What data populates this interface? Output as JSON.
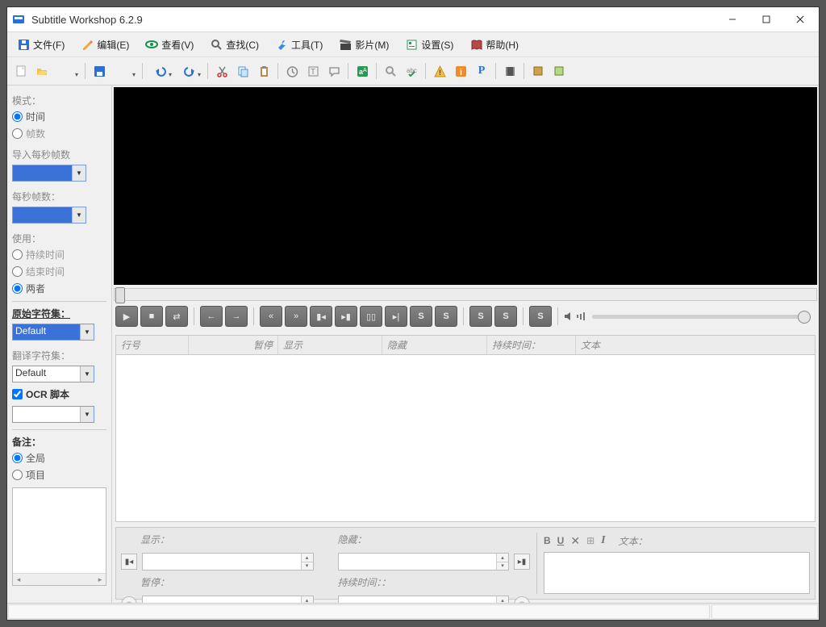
{
  "title": "Subtitle Workshop 6.2.9",
  "menu": {
    "file": "文件(F)",
    "edit": "编辑(E)",
    "view": "查看(V)",
    "search": "查找(C)",
    "tools": "工具(T)",
    "movie": "影片(M)",
    "settings": "设置(S)",
    "help": "帮助(H)"
  },
  "side": {
    "mode_label": "模式：",
    "mode_time": "时间",
    "mode_frames": "帧数",
    "import_fps_label": "导入每秒帧数",
    "import_fps_value": "",
    "fps_label": "每秒帧数：",
    "fps_value": "",
    "use_label": "使用：",
    "use_duration": "持续时间",
    "use_end": "结束时间",
    "use_both": "两者",
    "orig_charset_label": "原始字符集：",
    "orig_charset_value": "Default",
    "trans_charset_label": "翻译字符集：",
    "trans_charset_value": "Default",
    "ocr_label": "OCR 脚本",
    "ocr_value": "",
    "note_label": "备注：",
    "note_global": "全局",
    "note_project": "项目"
  },
  "cols": {
    "num": "行号",
    "pause": "暂停",
    "show": "显示",
    "hide": "隐藏",
    "duration": "持续时间：",
    "text": "文本"
  },
  "editor": {
    "show": "显示：",
    "hide": "隐藏：",
    "pause": "暂停：",
    "duration": "持续时间：：",
    "text_label": "文本：",
    "b": "B",
    "u": "U",
    "i": "I"
  }
}
